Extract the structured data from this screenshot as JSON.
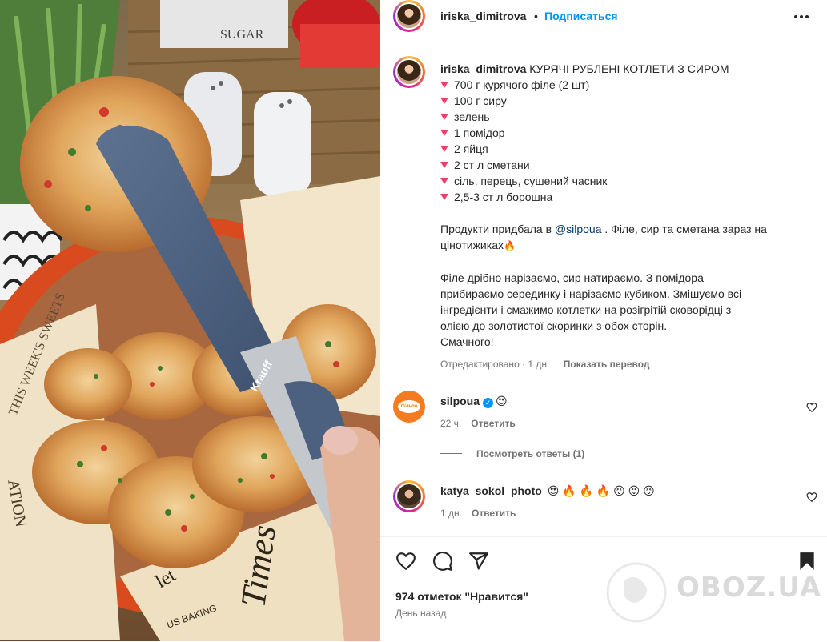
{
  "post": {
    "author": "iriska_dimitrova",
    "separator": "•",
    "follow_label": "Подписаться",
    "more_icon": "more-horizontal-icon"
  },
  "caption": {
    "author": "iriska_dimitrova",
    "title": "КУРЯЧІ РУБЛЕНІ КОТЛЕТИ З СИРОМ",
    "ingredients": [
      "700 г курячого філе (2 шт)",
      "100 г сиру",
      "зелень",
      "1 помідор",
      "2 яйця",
      "2 ст л сметани",
      "сіль, перець, сушений часник",
      "2,5-3 ст л борошна"
    ],
    "p1_before": "Продукти придбала в ",
    "p1_mention": "@silpoua",
    "p1_after": " . Філе, сир та сметана зараз на",
    "p1_line2": "цінотижиках",
    "fire": "🔥",
    "p2_lines": [
      "Філе дрібно нарізаємо, сир натираємо. З помідора",
      "прибираємо серединку і нарізаємо кубиком. Змішуємо всі",
      "інгредієнти і смажимо котлетки на розігрітій сковорідці з",
      "олією до золотистої скоринки з обох сторін.",
      "Смачного!"
    ],
    "edited": "Отредактировано · 1 дн.",
    "translate": "Показать перевод"
  },
  "comments": [
    {
      "user": "silpoua",
      "verified": "✓",
      "text": "😍",
      "age": "22 ч.",
      "reply": "Ответить",
      "avatar_label": "Сільпо"
    },
    {
      "user": "katya_sokol_photo",
      "text": "😍 🔥 🔥 🔥 😝 😝 😝",
      "age": "1 дн.",
      "reply": "Ответить"
    }
  ],
  "view_replies": "Посмотреть ответы (1)",
  "likes": "974 отметок \"Нравится\"",
  "posted": "День назад",
  "watermark": "OBOZ.UA",
  "photo_texts": {
    "tongs_brand": "Krauff",
    "paper_text_1": "THIS WEEK'S SWEETS",
    "paper_text_2": "ATION",
    "paper_text_3": "Times",
    "paper_text_4": "let",
    "paper_text_5": "US BAKING",
    "jar_text": "SUGAR"
  },
  "colors": {
    "accent_blue": "#0095f6",
    "text": "#262626",
    "muted": "#737373",
    "bullet": "#e7416a"
  }
}
